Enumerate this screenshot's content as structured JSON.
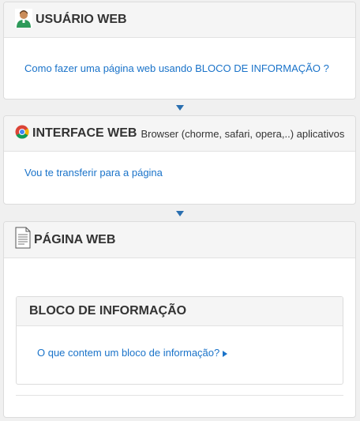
{
  "panel1": {
    "title": "USUÁRIO WEB",
    "icon": "user-avatar-icon",
    "link": "Como fazer uma página web usando BLOCO DE INFORMAÇÃO ?"
  },
  "panel2": {
    "title": "INTERFACE WEB",
    "subtitle": "Browser (chorme, safari, opera,..) aplicativos",
    "icon": "chrome-browser-icon",
    "link": "Vou te transferir para a página"
  },
  "panel3": {
    "title": "PÁGINA WEB",
    "icon": "document-icon",
    "inner_block": {
      "title": "BLOCO DE INFORMAÇÃO",
      "link": "O que contem um bloco de informação?"
    }
  },
  "colors": {
    "link": "#1a73c9",
    "arrow": "#2a6fb0",
    "header_bg": "#f5f5f5",
    "page_bg": "#f0f0f0"
  }
}
